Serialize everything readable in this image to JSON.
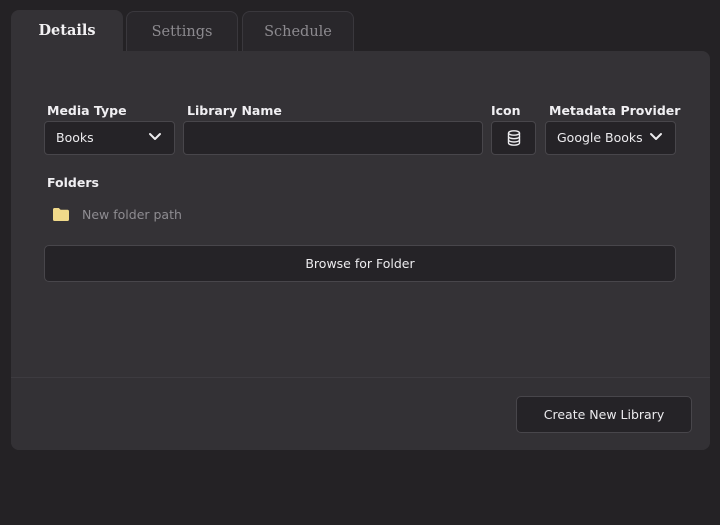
{
  "tabs": [
    {
      "label": "Details",
      "active": true
    },
    {
      "label": "Settings",
      "active": false
    },
    {
      "label": "Schedule",
      "active": false
    }
  ],
  "form": {
    "media_type": {
      "label": "Media Type",
      "value": "Books"
    },
    "library_name": {
      "label": "Library Name",
      "value": ""
    },
    "icon": {
      "label": "Icon",
      "icon_name": "database-icon"
    },
    "metadata_provider": {
      "label": "Metadata Provider",
      "value": "Google Books"
    }
  },
  "folders": {
    "label": "Folders",
    "placeholder": "New folder path",
    "folder_icon_color": "#f0d98a",
    "browse_button": "Browse for Folder"
  },
  "footer": {
    "create_button": "Create New Library"
  },
  "colors": {
    "background": "#242225",
    "panel": "#343236",
    "field": "#252327"
  }
}
